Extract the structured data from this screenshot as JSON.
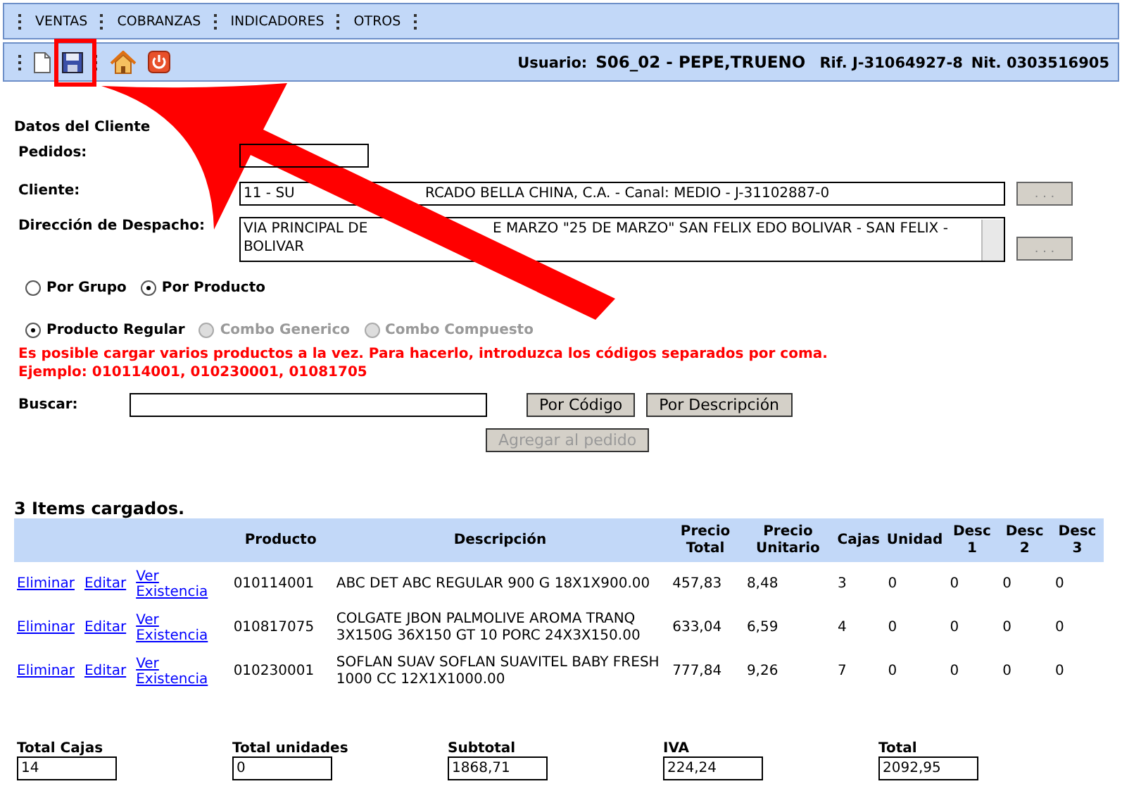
{
  "menu": [
    {
      "label": "VENTAS"
    },
    {
      "label": "COBRANZAS"
    },
    {
      "label": "INDICADORES"
    },
    {
      "label": "OTROS"
    }
  ],
  "toolbar": {
    "user_label": "Usuario:",
    "user": "S06_02 - PEPE,TRUENO",
    "rif": "Rif. J-31064927-8",
    "nit": "Nit. 0303516905"
  },
  "client": {
    "heading": "Datos del Cliente",
    "pedidos_label": "Pedidos:",
    "cliente_label": "Cliente:",
    "cliente_parts": [
      "11 - SU",
      "RCADO BELLA CHINA, C.A. -  Canal: MEDIO - J-31102887-0"
    ],
    "direccion_label": "Dirección de Despacho:",
    "direccion_parts": [
      "VIA PRINCIPAL DE",
      "E MARZO \"25 DE MARZO\" SAN FELIX EDO BOLIVAR - SAN FELIX -"
    ],
    "direccion_line2": "BOLIVAR",
    "browse_button": ". . ."
  },
  "mode": [
    {
      "label": "Por Grupo",
      "selected": false
    },
    {
      "label": "Por Producto",
      "selected": true
    }
  ],
  "product_type": [
    {
      "label": "Producto Regular",
      "selected": true,
      "disabled": false
    },
    {
      "label": "Combo Generico",
      "selected": false,
      "disabled": true
    },
    {
      "label": "Combo Compuesto",
      "selected": false,
      "disabled": true
    }
  ],
  "hint": [
    "Es posible cargar varios productos a la vez. Para hacerlo, introduzca los códigos separados por coma.",
    "Ejemplo: 010114001, 010230001, 01081705"
  ],
  "search": {
    "label": "Buscar:",
    "buttons": [
      "Por Código",
      "Por Descripción"
    ],
    "add_button": "Agregar al pedido",
    "add_disabled": true
  },
  "items_title": "3 Items cargados.",
  "table": {
    "columns": [
      "Producto",
      "Descripción",
      "Precio Total",
      "Precio Unitario",
      "Cajas",
      "Unidad",
      "Desc 1",
      "Desc 2",
      "Desc 3"
    ],
    "rows": [
      {
        "actions": [
          "Eliminar",
          "Editar",
          "Ver Existencia"
        ],
        "cells": [
          "010114001",
          "ABC DET ABC REGULAR 900 G 18X1X900.00",
          "457,83",
          "8,48",
          "3",
          "0",
          "0",
          "0",
          "0"
        ]
      },
      {
        "actions": [
          "Eliminar",
          "Editar",
          "Ver Existencia"
        ],
        "cells": [
          "010817075",
          "COLGATE JBON PALMOLIVE AROMA TRANQ 3X150G 36X150 GT 10 PORC 24X3X150.00",
          "633,04",
          "6,59",
          "4",
          "0",
          "0",
          "0",
          "0"
        ]
      },
      {
        "actions": [
          "Eliminar",
          "Editar",
          "Ver Existencia"
        ],
        "cells": [
          "010230001",
          "SOFLAN SUAV SOFLAN SUAVITEL BABY FRESH 1000 CC 12X1X1000.00",
          "777,84",
          "9,26",
          "7",
          "0",
          "0",
          "0",
          "0"
        ]
      }
    ]
  },
  "totals": [
    {
      "label": "Total Cajas",
      "value": "14"
    },
    {
      "label": "Total unidades",
      "value": "0"
    },
    {
      "label": "Subtotal",
      "value": "1868,71"
    },
    {
      "label": "IVA",
      "value": "224,24"
    },
    {
      "label": "Total",
      "value": "2092,95"
    }
  ]
}
